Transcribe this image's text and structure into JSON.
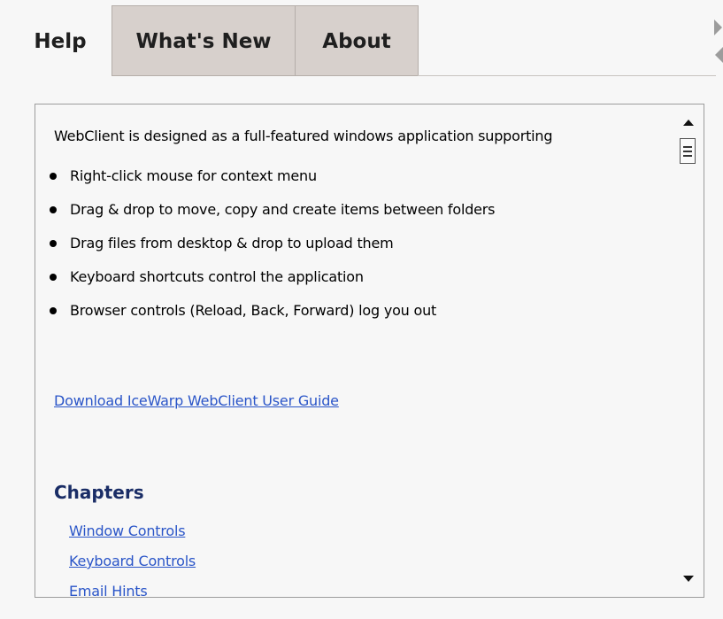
{
  "tabs": [
    {
      "label": "Help",
      "active": true
    },
    {
      "label": "What's New",
      "active": false
    },
    {
      "label": "About",
      "active": false
    }
  ],
  "help": {
    "intro": "WebClient is designed as a full-featured windows application supporting",
    "bullets": [
      "Right-click mouse for context menu",
      "Drag & drop to move, copy and create items between folders",
      "Drag files from desktop & drop to upload them",
      "Keyboard shortcuts control the application",
      "Browser controls (Reload, Back, Forward) log you out"
    ],
    "guide_link": "Download IceWarp WebClient User Guide",
    "chapters_title": "Chapters",
    "chapters": [
      "Window Controls",
      "Keyboard Controls",
      "Email Hints"
    ]
  },
  "colors": {
    "link": "#2a55c8",
    "heading": "#1a2d66",
    "tab_inactive": "#d7d0cc"
  }
}
